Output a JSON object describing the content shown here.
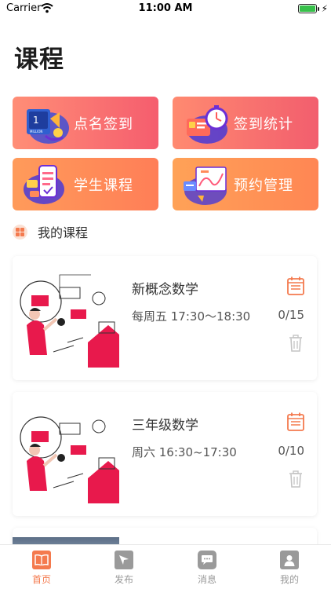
{
  "status_bar": {
    "carrier": "Carrier",
    "time": "11:00 AM"
  },
  "page": {
    "title": "课程"
  },
  "tiles": [
    {
      "label": "点名签到",
      "icon": "roll-call-icon"
    },
    {
      "label": "签到统计",
      "icon": "stopwatch-icon"
    },
    {
      "label": "学生课程",
      "icon": "phone-course-icon"
    },
    {
      "label": "预约管理",
      "icon": "chart-board-icon"
    }
  ],
  "tile_art_text": {
    "badge_number": "1",
    "badge_word": "MILLION"
  },
  "section": {
    "label": "我的课程",
    "icon": "grid-icon"
  },
  "courses": [
    {
      "name": "新概念数学",
      "schedule": "每周五 17:30～18:30",
      "count": "0/15"
    },
    {
      "name": "三年级数学",
      "schedule": "周六 16:30~17:30",
      "count": "0/10"
    }
  ],
  "tabs": [
    {
      "label": "首页",
      "icon": "book-icon",
      "active": true
    },
    {
      "label": "发布",
      "icon": "send-icon",
      "active": false
    },
    {
      "label": "消息",
      "icon": "message-icon",
      "active": false
    },
    {
      "label": "我的",
      "icon": "profile-icon",
      "active": false
    }
  ],
  "colors": {
    "accent": "#f47a4e",
    "tab_inactive": "#9a9a9a",
    "tile_red": "#f55d6e",
    "tile_orange": "#ff8654"
  }
}
